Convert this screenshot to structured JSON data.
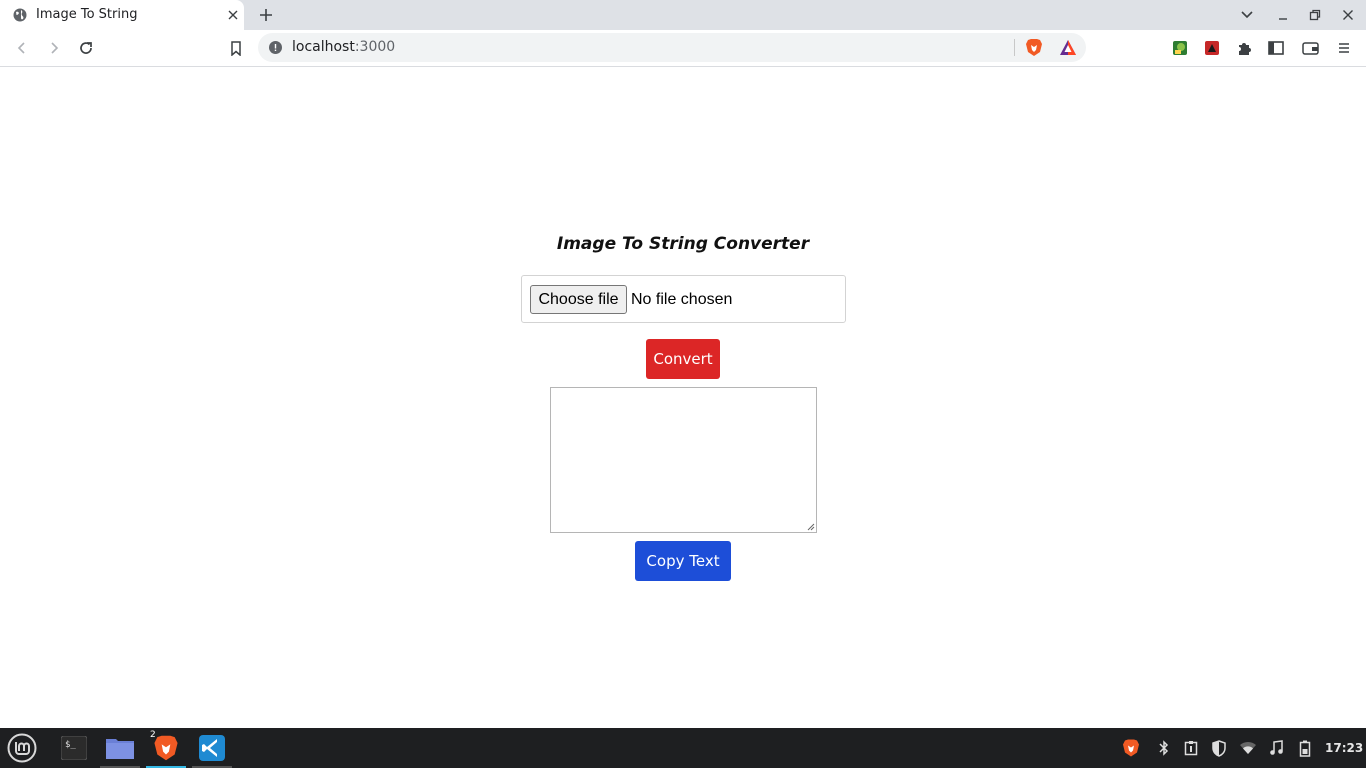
{
  "browser": {
    "tab_title": "Image To String",
    "url_host": "localhost",
    "url_port": ":3000",
    "icons": {
      "tab_favicon": "globe-icon",
      "tab_close": "close-icon",
      "new_tab": "plus-icon",
      "tab_search": "chevron-down-icon",
      "minimize": "minimize-icon",
      "maximize": "restore-icon",
      "close_window": "close-icon",
      "back": "back-arrow-icon",
      "forward": "forward-arrow-icon",
      "reload": "reload-icon",
      "bookmark": "bookmark-icon",
      "site_info": "info-icon",
      "brave_shields": "brave-lion-icon",
      "brave_rewards": "bat-triangle-icon",
      "extensions": "puzzle-icon",
      "sidebar": "sidebar-icon",
      "wallet": "wallet-icon",
      "menu": "hamburger-menu-icon"
    }
  },
  "page": {
    "heading": "Image To String Converter",
    "file_button_label": "Choose file",
    "file_status": "No file chosen",
    "convert_label": "Convert",
    "output_value": "",
    "copy_label": "Copy Text"
  },
  "colors": {
    "convert_bg": "#dc2626",
    "copy_bg": "#1d4ed8",
    "tab_strip": "#dee1e6",
    "taskbar": "#1e1f21",
    "active_app_underline": "#35b9e5"
  },
  "taskbar": {
    "apps": [
      {
        "name": "menu",
        "icon": "linux-mint-logo-icon"
      },
      {
        "name": "terminal",
        "icon": "terminal-icon"
      },
      {
        "name": "files",
        "icon": "folder-icon"
      },
      {
        "name": "brave",
        "icon": "brave-lion-icon",
        "badge": "2"
      },
      {
        "name": "vscode",
        "icon": "vscode-icon"
      }
    ],
    "tray_icons": [
      "brave-lion-icon",
      "bluetooth-icon",
      "clipboard-icon",
      "shield-icon",
      "wifi-icon",
      "music-note-icon",
      "battery-icon"
    ],
    "clock": "17:23"
  }
}
